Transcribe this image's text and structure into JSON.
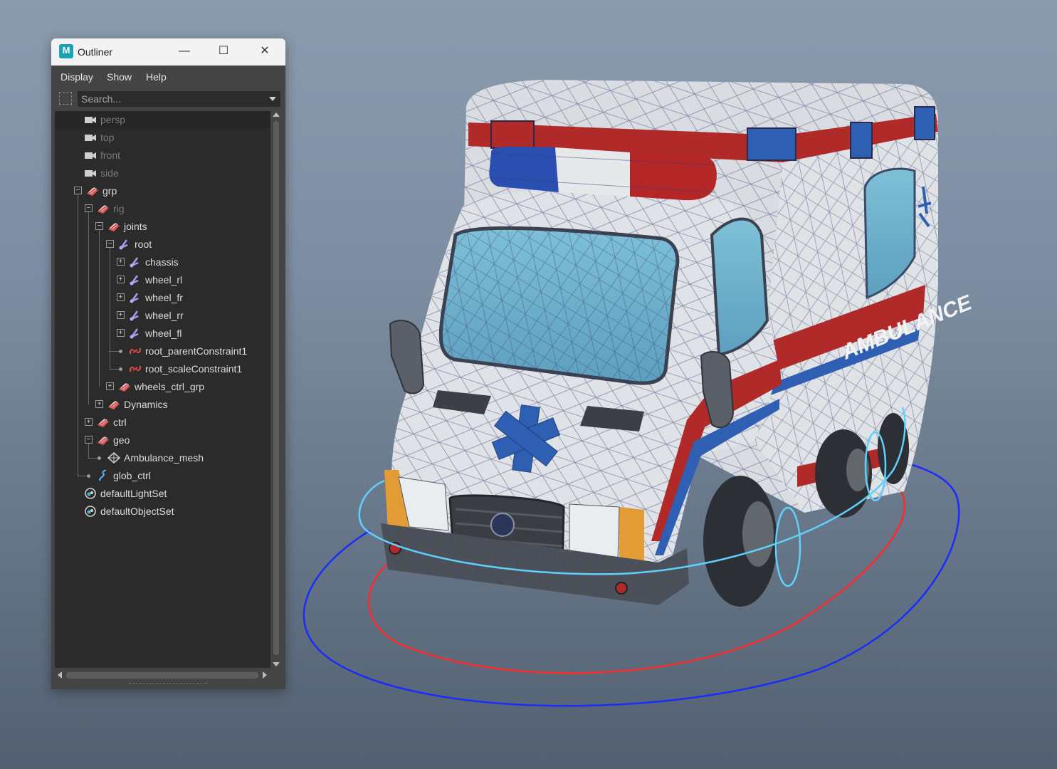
{
  "viewport": {
    "background_top": "#8a9bae",
    "background_bottom": "#526070",
    "decal_text": "AMBULANCE",
    "controls": {
      "ctrl_color": "#1a2bff",
      "glob_ctrl_color": "#ff2b2b",
      "wheel_ctrl_color": "#5fd0ff"
    }
  },
  "outliner": {
    "title": "Outliner",
    "app_icon": "M",
    "window_buttons": {
      "minimize": "—",
      "maximize": "☐",
      "close": "✕"
    },
    "menus": [
      "Display",
      "Show",
      "Help"
    ],
    "search": {
      "placeholder": "Search..."
    },
    "rows": [
      {
        "label": "persp",
        "icon": "camera-icon",
        "depth": 0,
        "dim": true,
        "selected": true,
        "toggle": "none"
      },
      {
        "label": "top",
        "icon": "camera-icon",
        "depth": 0,
        "dim": true,
        "toggle": "none"
      },
      {
        "label": "front",
        "icon": "camera-icon",
        "depth": 0,
        "dim": true,
        "toggle": "none"
      },
      {
        "label": "side",
        "icon": "camera-icon",
        "depth": 0,
        "dim": true,
        "toggle": "none"
      },
      {
        "label": "grp",
        "icon": "group-icon",
        "depth": 0,
        "toggle": "minus"
      },
      {
        "label": "rig",
        "icon": "group-icon",
        "depth": 1,
        "dim": true,
        "toggle": "minus"
      },
      {
        "label": "joints",
        "icon": "group-icon",
        "depth": 2,
        "toggle": "minus"
      },
      {
        "label": "root",
        "icon": "joint-icon",
        "depth": 3,
        "toggle": "minus"
      },
      {
        "label": "chassis",
        "icon": "joint-icon",
        "depth": 4,
        "toggle": "plus"
      },
      {
        "label": "wheel_rl",
        "icon": "joint-icon",
        "depth": 4,
        "toggle": "plus"
      },
      {
        "label": "wheel_fr",
        "icon": "joint-icon",
        "depth": 4,
        "toggle": "plus"
      },
      {
        "label": "wheel_rr",
        "icon": "joint-icon",
        "depth": 4,
        "toggle": "plus"
      },
      {
        "label": "wheel_fl",
        "icon": "joint-icon",
        "depth": 4,
        "toggle": "plus"
      },
      {
        "label": "root_parentConstraint1",
        "icon": "constraint-icon",
        "depth": 4,
        "toggle": "leaf"
      },
      {
        "label": "root_scaleConstraint1",
        "icon": "constraint-icon",
        "depth": 4,
        "toggle": "leaf"
      },
      {
        "label": "wheels_ctrl_grp",
        "icon": "group-icon",
        "depth": 3,
        "toggle": "plus"
      },
      {
        "label": "Dynamics",
        "icon": "group-icon",
        "depth": 2,
        "toggle": "plus"
      },
      {
        "label": "ctrl",
        "icon": "group-icon",
        "depth": 1,
        "toggle": "plus"
      },
      {
        "label": "geo",
        "icon": "group-icon",
        "depth": 1,
        "toggle": "minus"
      },
      {
        "label": "Ambulance_mesh",
        "icon": "mesh-icon",
        "depth": 2,
        "toggle": "leaf"
      },
      {
        "label": "glob_ctrl",
        "icon": "curve-icon",
        "depth": 1,
        "toggle": "leaf"
      },
      {
        "label": "defaultLightSet",
        "icon": "set-icon",
        "depth": 0,
        "toggle": "none"
      },
      {
        "label": "defaultObjectSet",
        "icon": "set-icon",
        "depth": 0,
        "toggle": "none"
      }
    ]
  }
}
